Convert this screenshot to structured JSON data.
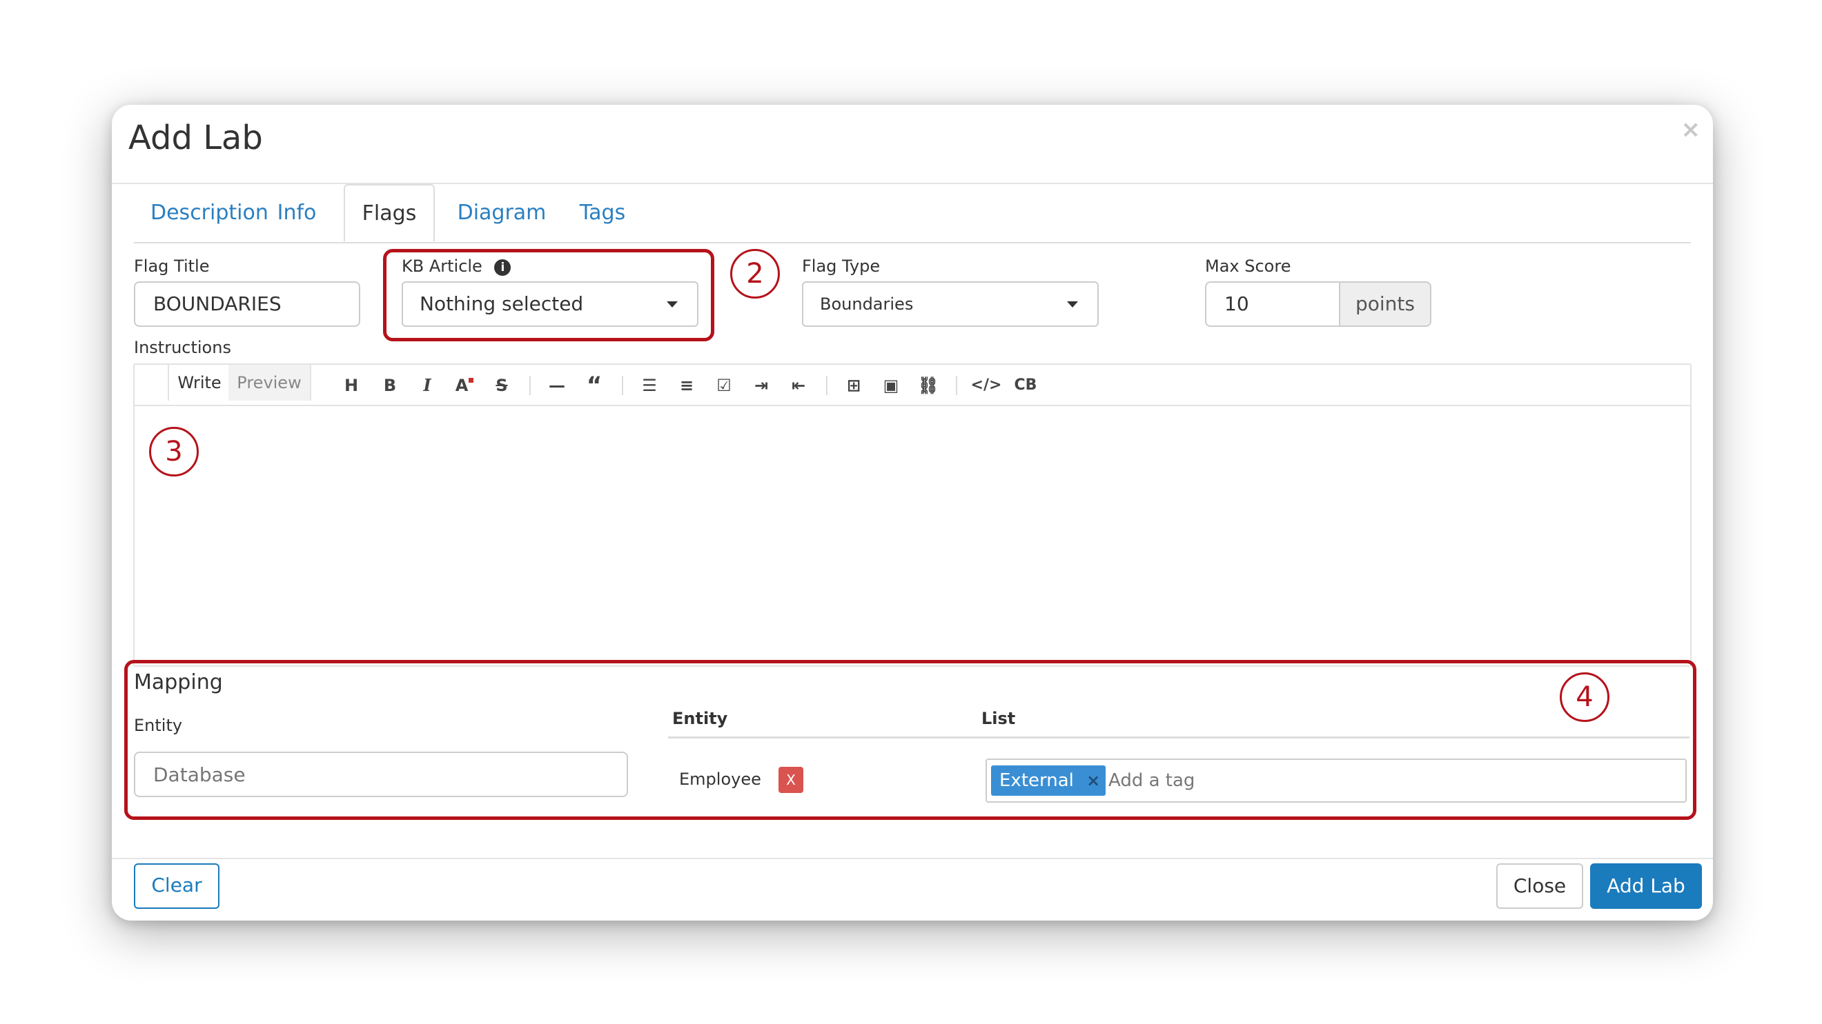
{
  "modal": {
    "title": "Add Lab",
    "close_glyph": "×"
  },
  "tabs": [
    {
      "label": "Description"
    },
    {
      "label": "Info"
    },
    {
      "label": "Flags"
    },
    {
      "label": "Diagram"
    },
    {
      "label": "Tags"
    }
  ],
  "active_tab": "Flags",
  "flag_title": {
    "label": "Flag Title",
    "value": "BOUNDARIES"
  },
  "kb_article": {
    "label": "KB Article",
    "selected": "Nothing selected",
    "info_icon": "info-icon"
  },
  "flag_type": {
    "label": "Flag Type",
    "selected": "Boundaries"
  },
  "max_score": {
    "label": "Max Score",
    "value": "10",
    "addon": "points"
  },
  "instructions": {
    "label": "Instructions",
    "write_tab": "Write",
    "preview_tab": "Preview",
    "toolbar": [
      {
        "glyph": "H",
        "icon": "heading-icon"
      },
      {
        "glyph": "B",
        "icon": "bold-icon"
      },
      {
        "glyph": "I",
        "icon": "italic-icon"
      },
      {
        "glyph": "A",
        "icon": "text-color-icon"
      },
      {
        "glyph": "S",
        "icon": "strikethrough-icon"
      },
      {
        "glyph": "—",
        "icon": "horizontal-rule-icon"
      },
      {
        "glyph": "“",
        "icon": "quote-icon"
      },
      {
        "glyph": "☰",
        "icon": "bullet-list-icon"
      },
      {
        "glyph": "≡",
        "icon": "numbered-list-icon"
      },
      {
        "glyph": "☑",
        "icon": "task-list-icon"
      },
      {
        "glyph": "⇥",
        "icon": "indent-icon"
      },
      {
        "glyph": "⇤",
        "icon": "outdent-icon"
      },
      {
        "glyph": "⊞",
        "icon": "table-icon"
      },
      {
        "glyph": "▣",
        "icon": "image-icon"
      },
      {
        "glyph": "⛓",
        "icon": "link-icon"
      },
      {
        "glyph": "</>",
        "icon": "code-icon"
      },
      {
        "glyph": "CB",
        "icon": "code-block-icon"
      }
    ]
  },
  "mapping": {
    "title": "Mapping",
    "entity_label": "Entity",
    "entity_placeholder": "Database",
    "table_headers": {
      "entity": "Entity",
      "list": "List"
    },
    "row": {
      "entity": "Employee",
      "remove": "X",
      "tag": "External",
      "tag_remove": "×",
      "tag_placeholder": "Add a tag"
    }
  },
  "annotations": {
    "two": "2",
    "three": "3",
    "four": "4"
  },
  "footer": {
    "clear": "Clear",
    "close": "Close",
    "add_lab": "Add Lab"
  },
  "colors": {
    "accent": "#1a7bbd",
    "annotation": "#b5121b",
    "tag": "#3a8fd4",
    "danger": "#d9534f"
  }
}
